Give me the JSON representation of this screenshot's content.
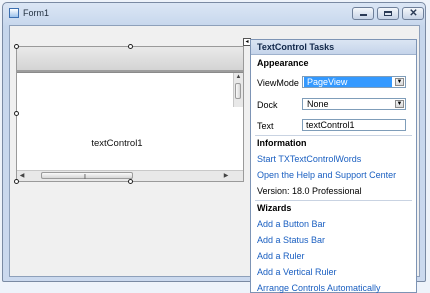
{
  "window": {
    "title": "Form1"
  },
  "designer": {
    "control_label": "textControl1"
  },
  "tasks": {
    "title": "TextControl Tasks",
    "appearance": {
      "heading": "Appearance",
      "viewmode_label": "ViewMode",
      "viewmode_value": "PageView",
      "dock_label": "Dock",
      "dock_value": "None",
      "text_label": "Text",
      "text_value": "textControl1"
    },
    "information": {
      "heading": "Information",
      "link_start": "Start TXTextControlWords",
      "link_help": "Open the Help and Support Center",
      "version": "Version: 18.0 Professional"
    },
    "wizards": {
      "heading": "Wizards",
      "items": [
        "Add a Button Bar",
        "Add a Status Bar",
        "Add a Ruler",
        "Add a Vertical Ruler",
        "Arrange Controls Automatically"
      ]
    }
  },
  "icons": {
    "minimize": "minimize-icon",
    "maximize": "maximize-icon",
    "close": "close-icon",
    "dropdown": "chevron-down-icon",
    "smart_tag": "smart-tag-icon"
  },
  "colors": {
    "selection": "#3399ff",
    "link": "#1a5fc1",
    "panel_header": "#c5d4ea"
  }
}
